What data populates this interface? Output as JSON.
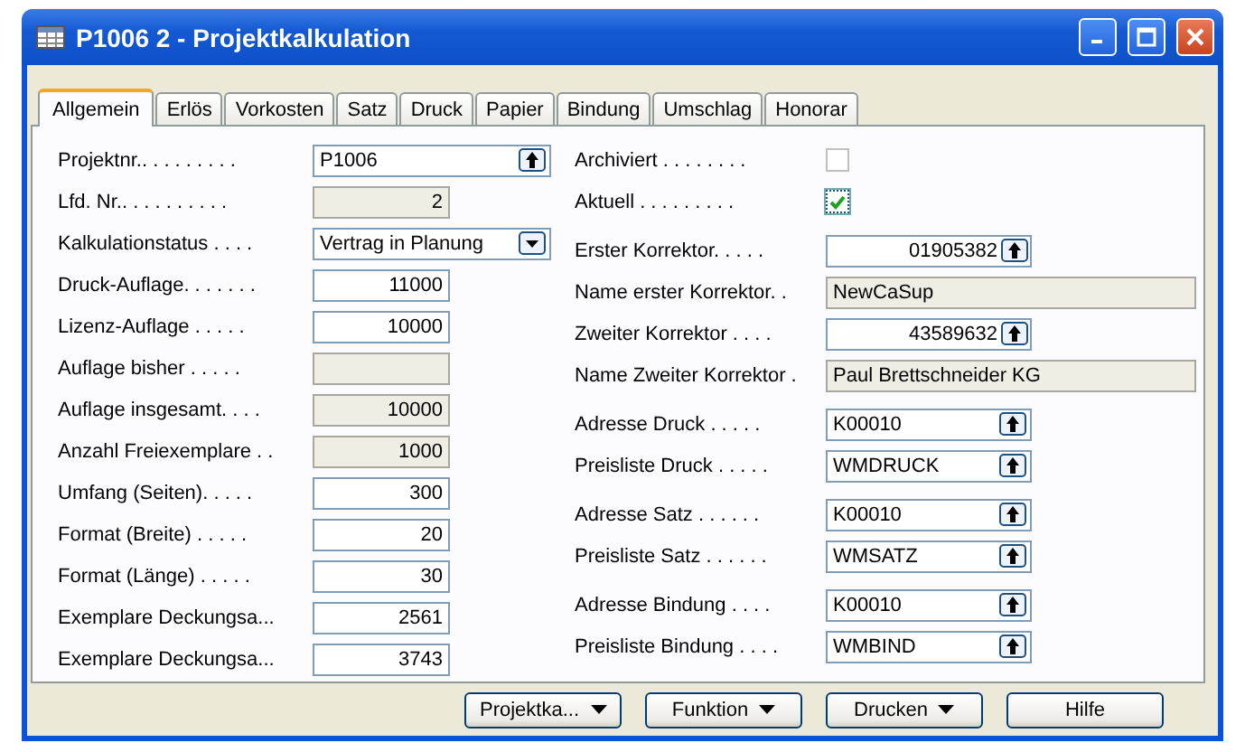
{
  "window": {
    "title": "P1006 2 - Projektkalkulation"
  },
  "tabs": [
    {
      "label": "Allgemein",
      "selected": true
    },
    {
      "label": "Erlös",
      "selected": false
    },
    {
      "label": "Vorkosten",
      "selected": false
    },
    {
      "label": "Satz",
      "selected": false
    },
    {
      "label": "Druck",
      "selected": false
    },
    {
      "label": "Papier",
      "selected": false
    },
    {
      "label": "Bindung",
      "selected": false
    },
    {
      "label": "Umschlag",
      "selected": false
    },
    {
      "label": "Honorar",
      "selected": false
    }
  ],
  "left_fields": [
    {
      "label": "Projektnr.. . . . . . . . .",
      "kind": "lookup",
      "value": "P1006"
    },
    {
      "label": "Lfd. Nr.. . . . . . . . . .",
      "kind": "number-readonly",
      "value": "2"
    },
    {
      "label": "Kalkulationstatus . . . .",
      "kind": "dropdown",
      "value": "Vertrag in Planung"
    },
    {
      "label": "Druck-Auflage. . . . . . .",
      "kind": "number",
      "value": "11000"
    },
    {
      "label": "Lizenz-Auflage . . . . .",
      "kind": "number",
      "value": "10000"
    },
    {
      "label": "Auflage bisher . . . . .",
      "kind": "number-readonly"
    },
    {
      "label": "Auflage insgesamt. . . .",
      "kind": "number-readonly",
      "value": "10000"
    },
    {
      "label": "Anzahl Freiexemplare . .",
      "kind": "number-readonly",
      "value": "1000"
    },
    {
      "label": "Umfang (Seiten). . . . .",
      "kind": "number",
      "value": "300"
    },
    {
      "label": "Format (Breite) . . . . .",
      "kind": "number",
      "value": "20"
    },
    {
      "label": "Format (Länge) . . . . .",
      "kind": "number",
      "value": "30"
    },
    {
      "label": "Exemplare Deckungsa...",
      "kind": "number",
      "value": "2561"
    },
    {
      "label": "Exemplare Deckungsa...",
      "kind": "number",
      "value": "3743"
    }
  ],
  "right_groups": [
    [
      {
        "label": "Archiviert . . . . . . . .",
        "kind": "checkbox",
        "checked": false
      },
      {
        "label": "Aktuell . . . . . . . . .",
        "kind": "checkbox",
        "checked": true
      }
    ],
    [
      {
        "label": "Erster Korrektor. . . . .",
        "kind": "number-lookup",
        "value": "01905382"
      },
      {
        "label": "Name erster Korrektor. .",
        "kind": "text-readonly",
        "value": "NewCaSup"
      },
      {
        "label": "Zweiter Korrektor . . . .",
        "kind": "number-lookup",
        "value": "43589632"
      },
      {
        "label": "Name Zweiter Korrektor .",
        "kind": "text-readonly",
        "value": "Paul Brettschneider KG"
      }
    ],
    [
      {
        "label": "Adresse Druck . . . . .",
        "kind": "lookup",
        "value": "K00010"
      },
      {
        "label": "Preisliste Druck . . . . .",
        "kind": "lookup",
        "value": "WMDRUCK"
      }
    ],
    [
      {
        "label": "Adresse Satz . . . . . .",
        "kind": "lookup",
        "value": "K00010"
      },
      {
        "label": "Preisliste Satz . . . . . .",
        "kind": "lookup",
        "value": "WMSATZ"
      }
    ],
    [
      {
        "label": "Adresse Bindung . . . .",
        "kind": "lookup",
        "value": "K00010"
      },
      {
        "label": "Preisliste Bindung . . . .",
        "kind": "lookup",
        "value": "WMBIND"
      }
    ]
  ],
  "buttons": [
    {
      "label": "Projektka...",
      "menu": true
    },
    {
      "label": "Funktion",
      "menu": true
    },
    {
      "label": "Drucken",
      "menu": true
    },
    {
      "label": "Hilfe",
      "menu": false
    }
  ]
}
